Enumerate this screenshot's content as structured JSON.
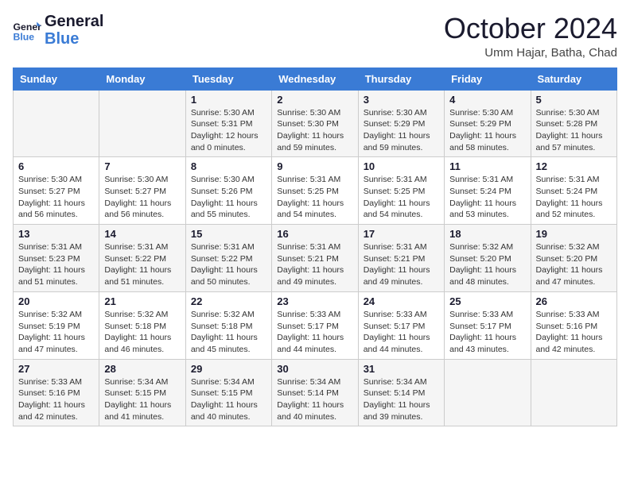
{
  "header": {
    "logo_general": "General",
    "logo_blue": "Blue",
    "month_title": "October 2024",
    "location": "Umm Hajar, Batha, Chad"
  },
  "calendar": {
    "days_of_week": [
      "Sunday",
      "Monday",
      "Tuesday",
      "Wednesday",
      "Thursday",
      "Friday",
      "Saturday"
    ],
    "weeks": [
      [
        {
          "day": "",
          "info": ""
        },
        {
          "day": "",
          "info": ""
        },
        {
          "day": "1",
          "info": "Sunrise: 5:30 AM\nSunset: 5:31 PM\nDaylight: 12 hours\nand 0 minutes."
        },
        {
          "day": "2",
          "info": "Sunrise: 5:30 AM\nSunset: 5:30 PM\nDaylight: 11 hours\nand 59 minutes."
        },
        {
          "day": "3",
          "info": "Sunrise: 5:30 AM\nSunset: 5:29 PM\nDaylight: 11 hours\nand 59 minutes."
        },
        {
          "day": "4",
          "info": "Sunrise: 5:30 AM\nSunset: 5:29 PM\nDaylight: 11 hours\nand 58 minutes."
        },
        {
          "day": "5",
          "info": "Sunrise: 5:30 AM\nSunset: 5:28 PM\nDaylight: 11 hours\nand 57 minutes."
        }
      ],
      [
        {
          "day": "6",
          "info": "Sunrise: 5:30 AM\nSunset: 5:27 PM\nDaylight: 11 hours\nand 56 minutes."
        },
        {
          "day": "7",
          "info": "Sunrise: 5:30 AM\nSunset: 5:27 PM\nDaylight: 11 hours\nand 56 minutes."
        },
        {
          "day": "8",
          "info": "Sunrise: 5:30 AM\nSunset: 5:26 PM\nDaylight: 11 hours\nand 55 minutes."
        },
        {
          "day": "9",
          "info": "Sunrise: 5:31 AM\nSunset: 5:25 PM\nDaylight: 11 hours\nand 54 minutes."
        },
        {
          "day": "10",
          "info": "Sunrise: 5:31 AM\nSunset: 5:25 PM\nDaylight: 11 hours\nand 54 minutes."
        },
        {
          "day": "11",
          "info": "Sunrise: 5:31 AM\nSunset: 5:24 PM\nDaylight: 11 hours\nand 53 minutes."
        },
        {
          "day": "12",
          "info": "Sunrise: 5:31 AM\nSunset: 5:24 PM\nDaylight: 11 hours\nand 52 minutes."
        }
      ],
      [
        {
          "day": "13",
          "info": "Sunrise: 5:31 AM\nSunset: 5:23 PM\nDaylight: 11 hours\nand 51 minutes."
        },
        {
          "day": "14",
          "info": "Sunrise: 5:31 AM\nSunset: 5:22 PM\nDaylight: 11 hours\nand 51 minutes."
        },
        {
          "day": "15",
          "info": "Sunrise: 5:31 AM\nSunset: 5:22 PM\nDaylight: 11 hours\nand 50 minutes."
        },
        {
          "day": "16",
          "info": "Sunrise: 5:31 AM\nSunset: 5:21 PM\nDaylight: 11 hours\nand 49 minutes."
        },
        {
          "day": "17",
          "info": "Sunrise: 5:31 AM\nSunset: 5:21 PM\nDaylight: 11 hours\nand 49 minutes."
        },
        {
          "day": "18",
          "info": "Sunrise: 5:32 AM\nSunset: 5:20 PM\nDaylight: 11 hours\nand 48 minutes."
        },
        {
          "day": "19",
          "info": "Sunrise: 5:32 AM\nSunset: 5:20 PM\nDaylight: 11 hours\nand 47 minutes."
        }
      ],
      [
        {
          "day": "20",
          "info": "Sunrise: 5:32 AM\nSunset: 5:19 PM\nDaylight: 11 hours\nand 47 minutes."
        },
        {
          "day": "21",
          "info": "Sunrise: 5:32 AM\nSunset: 5:18 PM\nDaylight: 11 hours\nand 46 minutes."
        },
        {
          "day": "22",
          "info": "Sunrise: 5:32 AM\nSunset: 5:18 PM\nDaylight: 11 hours\nand 45 minutes."
        },
        {
          "day": "23",
          "info": "Sunrise: 5:33 AM\nSunset: 5:17 PM\nDaylight: 11 hours\nand 44 minutes."
        },
        {
          "day": "24",
          "info": "Sunrise: 5:33 AM\nSunset: 5:17 PM\nDaylight: 11 hours\nand 44 minutes."
        },
        {
          "day": "25",
          "info": "Sunrise: 5:33 AM\nSunset: 5:17 PM\nDaylight: 11 hours\nand 43 minutes."
        },
        {
          "day": "26",
          "info": "Sunrise: 5:33 AM\nSunset: 5:16 PM\nDaylight: 11 hours\nand 42 minutes."
        }
      ],
      [
        {
          "day": "27",
          "info": "Sunrise: 5:33 AM\nSunset: 5:16 PM\nDaylight: 11 hours\nand 42 minutes."
        },
        {
          "day": "28",
          "info": "Sunrise: 5:34 AM\nSunset: 5:15 PM\nDaylight: 11 hours\nand 41 minutes."
        },
        {
          "day": "29",
          "info": "Sunrise: 5:34 AM\nSunset: 5:15 PM\nDaylight: 11 hours\nand 40 minutes."
        },
        {
          "day": "30",
          "info": "Sunrise: 5:34 AM\nSunset: 5:14 PM\nDaylight: 11 hours\nand 40 minutes."
        },
        {
          "day": "31",
          "info": "Sunrise: 5:34 AM\nSunset: 5:14 PM\nDaylight: 11 hours\nand 39 minutes."
        },
        {
          "day": "",
          "info": ""
        },
        {
          "day": "",
          "info": ""
        }
      ]
    ]
  }
}
